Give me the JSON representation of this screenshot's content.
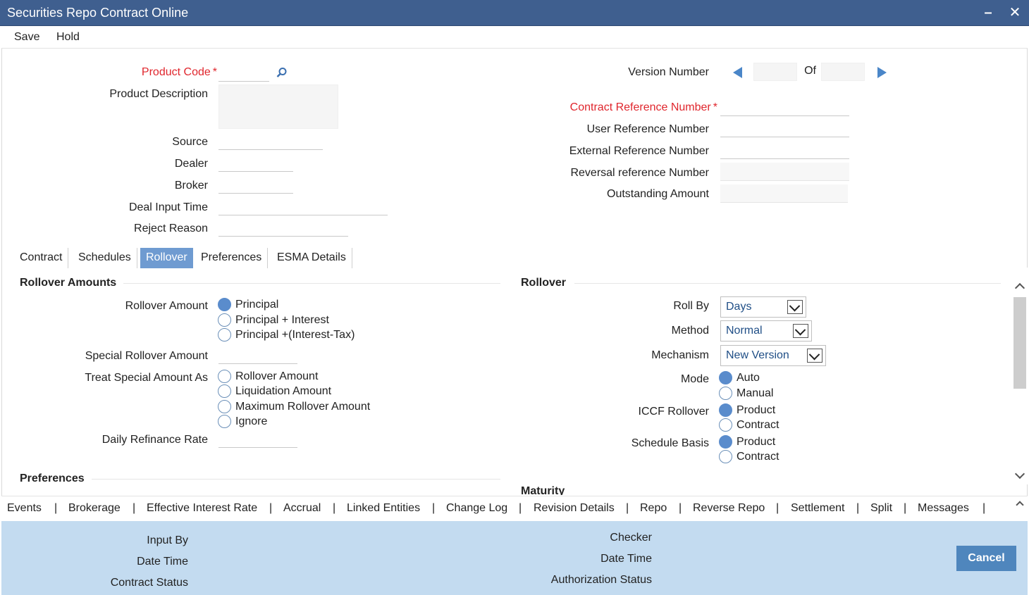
{
  "window": {
    "title": "Securities Repo Contract Online",
    "minimize": "–",
    "close": "✕"
  },
  "menu": {
    "save": "Save",
    "hold": "Hold"
  },
  "header": {
    "product_code": "Product Code",
    "product_description": "Product Description",
    "source": "Source",
    "dealer": "Dealer",
    "broker": "Broker",
    "deal_input_time": "Deal Input Time",
    "reject_reason": "Reject Reason",
    "version_number": "Version Number",
    "of": "Of",
    "contract_reference_number": "Contract Reference Number",
    "user_reference_number": "User Reference Number",
    "external_reference_number": "External Reference Number",
    "reversal_reference_number": "Reversal reference Number",
    "outstanding_amount": "Outstanding Amount",
    "required_mark": "*"
  },
  "tabs": [
    "Contract",
    "Schedules",
    "Rollover",
    "Preferences",
    "ESMA Details"
  ],
  "rollover_amounts": {
    "title": "Rollover Amounts",
    "rollover_amount_label": "Rollover Amount",
    "rollover_amount_options": [
      "Principal",
      "Principal + Interest",
      "Principal +(Interest-Tax)"
    ],
    "rollover_amount_selected": "Principal",
    "special_rollover_amount": "Special Rollover Amount",
    "treat_special_amount_as": "Treat Special Amount As",
    "treat_options": [
      "Rollover Amount",
      "Liquidation Amount",
      "Maximum Rollover Amount",
      "Ignore"
    ],
    "daily_refinance_rate": "Daily Refinance Rate",
    "preferences_title": "Preferences"
  },
  "rollover": {
    "title": "Rollover",
    "roll_by_label": "Roll By",
    "roll_by_value": "Days",
    "method_label": "Method",
    "method_value": "Normal",
    "mechanism_label": "Mechanism",
    "mechanism_value": "New Version",
    "mode_label": "Mode",
    "mode_options": [
      "Auto",
      "Manual"
    ],
    "mode_selected": "Auto",
    "iccf_label": "ICCF Rollover",
    "iccf_options": [
      "Product",
      "Contract"
    ],
    "iccf_selected": "Product",
    "schedule_basis_label": "Schedule Basis",
    "schedule_options": [
      "Product",
      "Contract"
    ],
    "schedule_selected": "Product",
    "maturity_title": "Maturity"
  },
  "bottom_links": [
    "Events",
    "Brokerage",
    "Effective Interest Rate",
    "Accrual",
    "Linked Entities",
    "Change Log",
    "Revision Details",
    "Repo",
    "Reverse Repo",
    "Settlement",
    "Split",
    "Messages"
  ],
  "bottom_separator": "|",
  "footer": {
    "input_by": "Input By",
    "date_time_left": "Date Time",
    "contract_status": "Contract Status",
    "checker": "Checker",
    "date_time_right": "Date Time",
    "authorization_status": "Authorization Status",
    "cancel": "Cancel"
  },
  "colors": {
    "title_bar": "#3f5f8f",
    "required": "#e0262d",
    "active_tab": "#6f9bd1",
    "footer_bg": "#c3dbf0",
    "cancel_button": "#4f86bd",
    "radio_selected": "#5a8ccc"
  }
}
